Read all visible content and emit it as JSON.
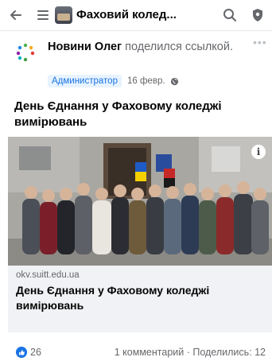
{
  "topbar": {
    "title": "Фаховий колед...",
    "icons": [
      "back-arrow-icon",
      "menu-icon",
      "group-avatar",
      "search-icon",
      "shield-icon"
    ]
  },
  "post": {
    "author_name": "Новини Олег",
    "action_text": " поделился ссылкой.",
    "role_badge": "Администратор",
    "date": "16 февр.",
    "text": "День Єднання у Фаховому коледжі вимірювань",
    "link": {
      "domain": "okv.suitt.edu.ua",
      "title": "День Єднання у Фаховому коледжі вимірювань"
    },
    "reactions": {
      "count": "26",
      "stats": "1 комментарий · Поделились: 12"
    }
  },
  "colors": {
    "accent": "#1b74e4",
    "badge_bg": "#e7f3ff",
    "card_bg": "#f0f2f5",
    "muted_text": "#65676b"
  }
}
